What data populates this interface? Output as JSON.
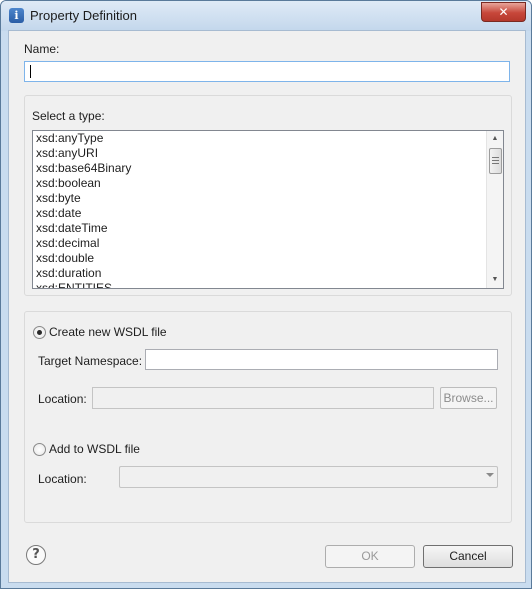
{
  "window": {
    "title": "Property Definition",
    "close_glyph": "✕",
    "title_icon_glyph": "i"
  },
  "name": {
    "label": "Name:",
    "value": ""
  },
  "type_group": {
    "label": "Select a type:",
    "items": [
      "xsd:anyType",
      "xsd:anyURI",
      "xsd:base64Binary",
      "xsd:boolean",
      "xsd:byte",
      "xsd:date",
      "xsd:dateTime",
      "xsd:decimal",
      "xsd:double",
      "xsd:duration",
      "xsd:ENTITIES"
    ],
    "scroll_up_glyph": "▲",
    "scroll_down_glyph": "▼"
  },
  "wsdl": {
    "create_label": "Create new WSDL file",
    "create_selected": true,
    "target_ns_label": "Target Namespace:",
    "target_ns_value": "",
    "location_label": "Location:",
    "location_value": "",
    "browse_label": "Browse...",
    "add_label": "Add to WSDL file",
    "add_selected": false,
    "add_location_label": "Location:",
    "add_location_value": ""
  },
  "footer": {
    "help_glyph": "?",
    "ok_label": "OK",
    "cancel_label": "Cancel"
  },
  "colors": {
    "titlebar": "#c9dcef",
    "close": "#c7473a",
    "focus_border": "#7eb4ea",
    "dialog_bg": "#f0f0f0"
  }
}
